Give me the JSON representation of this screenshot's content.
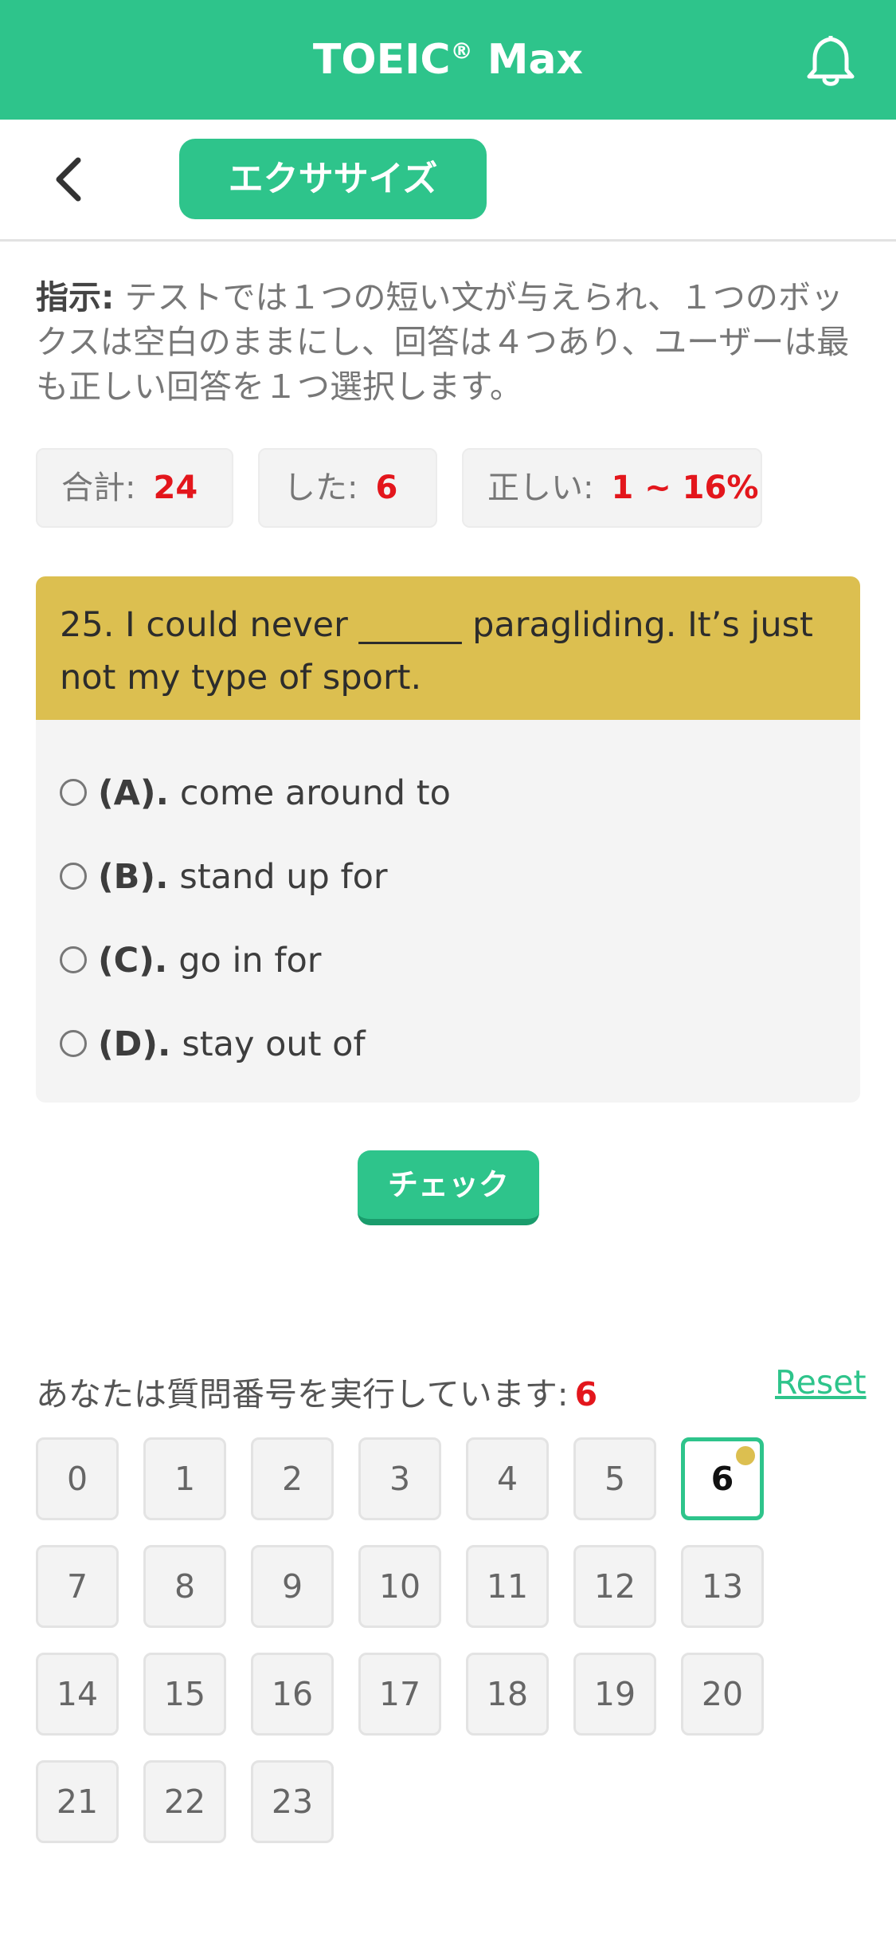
{
  "app": {
    "title": "TOEIC",
    "title_mark": "®",
    "title_suffix": "Max"
  },
  "toolbar": {
    "tab_label": "エクササイズ"
  },
  "instructions": {
    "label": "指示:",
    "text": "テストでは１つの短い文が与えられ、１つのボックスは空白のままにし、回答は４つあり、ユーザーは最も正しい回答を１つ選択します。"
  },
  "stats": {
    "total_label": "合計:",
    "total_value": "24",
    "done_label": "した:",
    "done_value": "6",
    "correct_label": "正しい:",
    "correct_value": "1 ~ 16%"
  },
  "question": {
    "text": "25. I could never ______ paragliding. It’s just not my type of sport.",
    "options": [
      {
        "letter": "(A).",
        "text": "come around to"
      },
      {
        "letter": "(B).",
        "text": "stand up for"
      },
      {
        "letter": "(C).",
        "text": "go in for"
      },
      {
        "letter": "(D).",
        "text": "stay out of"
      }
    ]
  },
  "check_label": "チェック",
  "progress": {
    "label": "あなたは質問番号を実行しています:",
    "current": "6",
    "reset_label": "Reset"
  },
  "question_numbers": [
    "0",
    "1",
    "2",
    "3",
    "4",
    "5",
    "6",
    "7",
    "8",
    "9",
    "10",
    "11",
    "12",
    "13",
    "14",
    "15",
    "16",
    "17",
    "18",
    "19",
    "20",
    "21",
    "22",
    "23"
  ],
  "colors": {
    "primary": "#2ec48b",
    "question_header": "#dcbf50",
    "accent_red": "#e3161c"
  },
  "icons": {
    "bell": "bell-icon",
    "back": "chevron-left-icon"
  }
}
